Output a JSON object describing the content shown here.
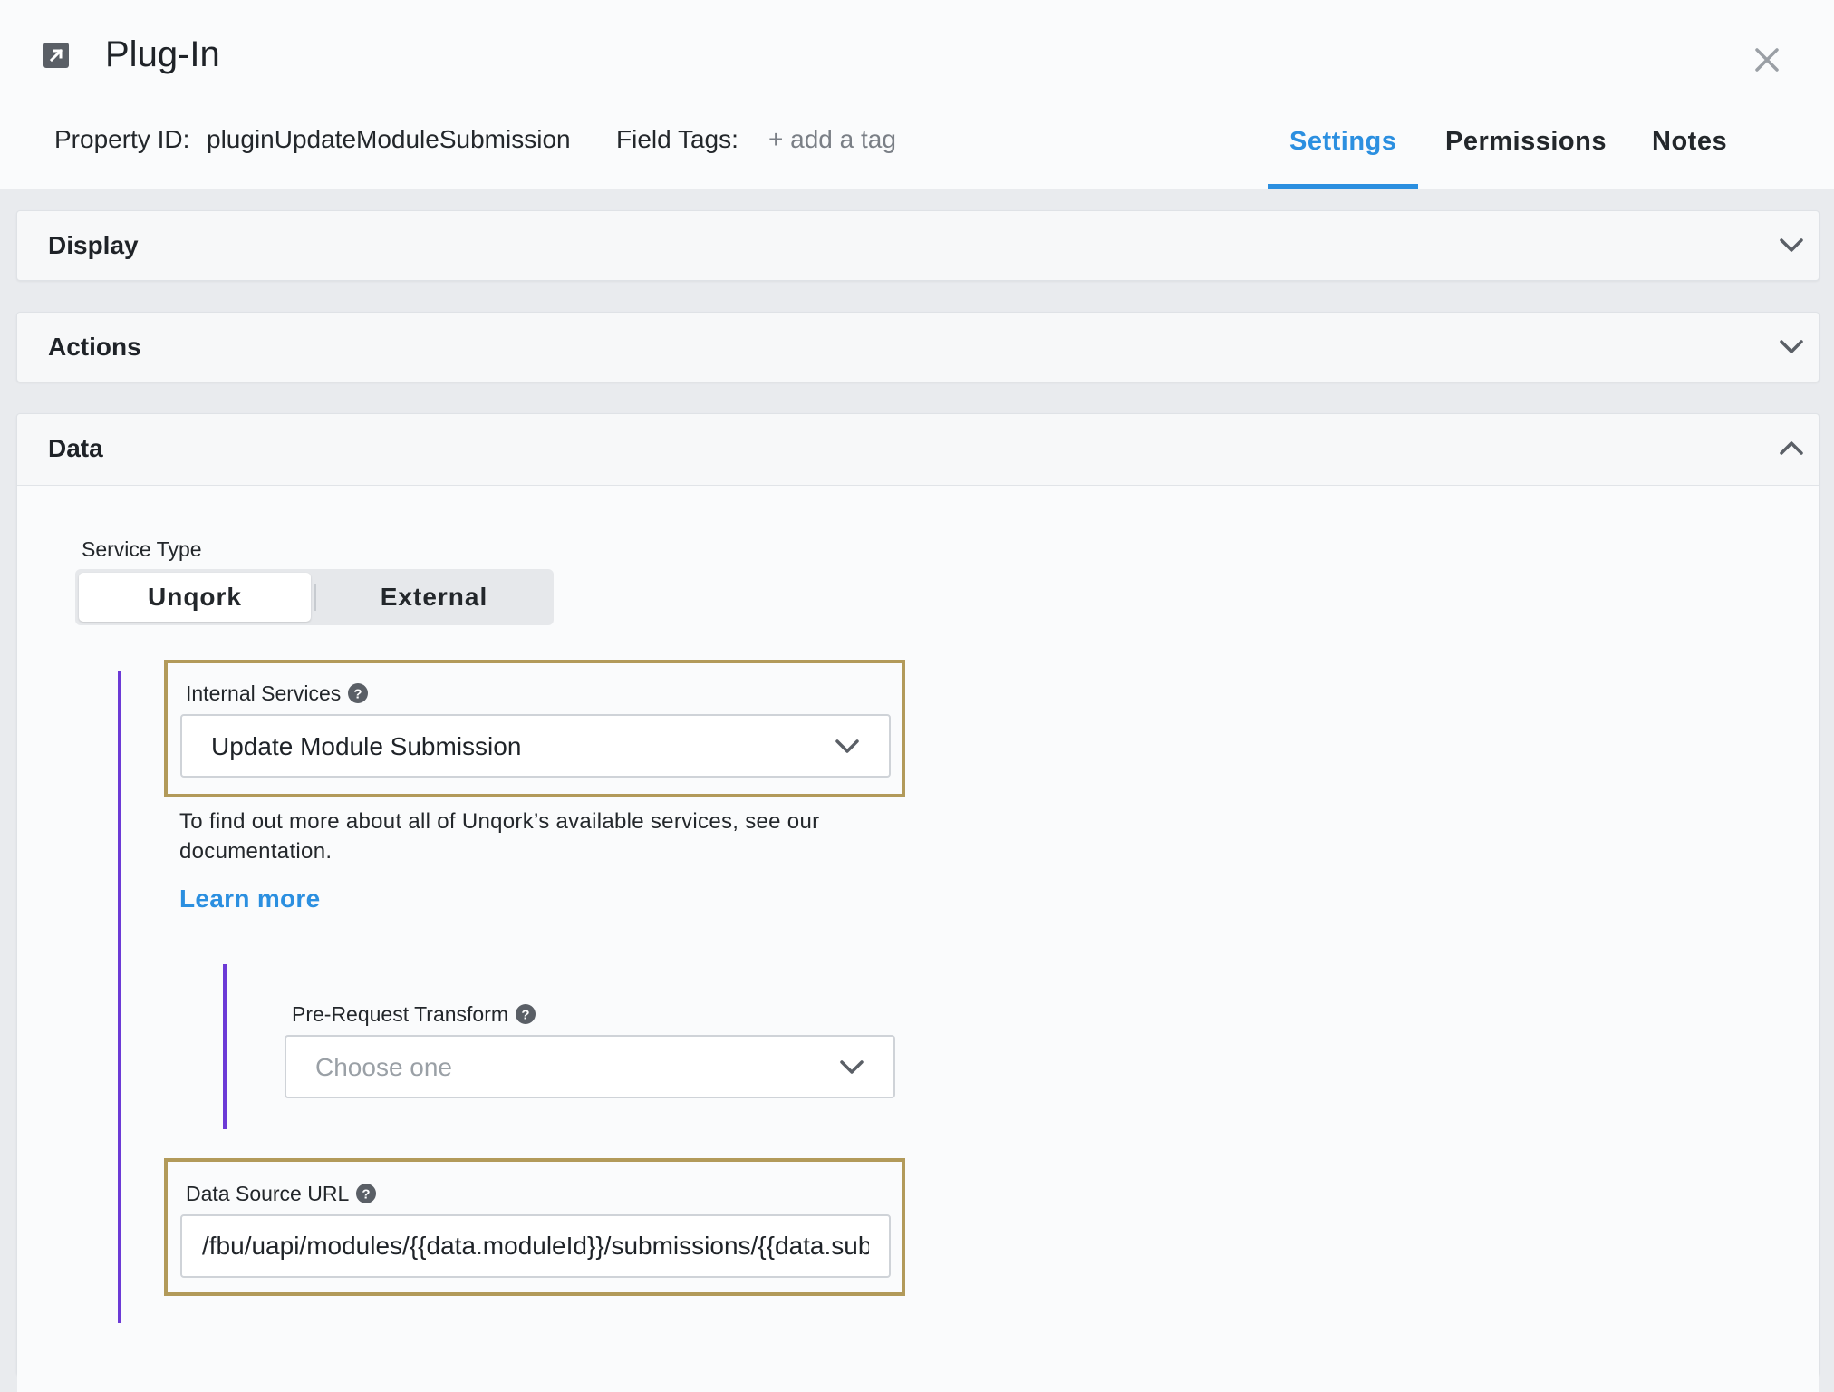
{
  "window": {
    "title": "Plug-In",
    "close_label": "Close"
  },
  "meta": {
    "property_id_label": "Property ID:",
    "property_id_value": "pluginUpdateModuleSubmission",
    "field_tags_label": "Field Tags:",
    "add_tag_label": "+ add a tag"
  },
  "tabs": [
    {
      "label": "Settings",
      "active": true
    },
    {
      "label": "Permissions",
      "active": false
    },
    {
      "label": "Notes",
      "active": false
    }
  ],
  "sections": {
    "display": {
      "title": "Display",
      "expanded": false
    },
    "actions": {
      "title": "Actions",
      "expanded": false
    },
    "data": {
      "title": "Data",
      "expanded": true
    }
  },
  "data_panel": {
    "service_type_label": "Service Type",
    "service_type_options": [
      "Unqork",
      "External"
    ],
    "service_type_selected": "Unqork",
    "internal_services_label": "Internal Services",
    "internal_services_value": "Update Module Submission",
    "description": "To find out more about all of Unqork’s available services, see our documentation.",
    "learn_more_label": "Learn more",
    "pre_request_label": "Pre-Request Transform",
    "pre_request_placeholder": "Choose one",
    "data_source_label": "Data Source URL",
    "data_source_value": "/fbu/uapi/modules/{{data.moduleId}}/submissions/{{data.submissionId}}"
  },
  "colors": {
    "accent": "#2b8fe0",
    "highlight_border": "#b29a5a",
    "branch_line": "#6c3ad6"
  }
}
